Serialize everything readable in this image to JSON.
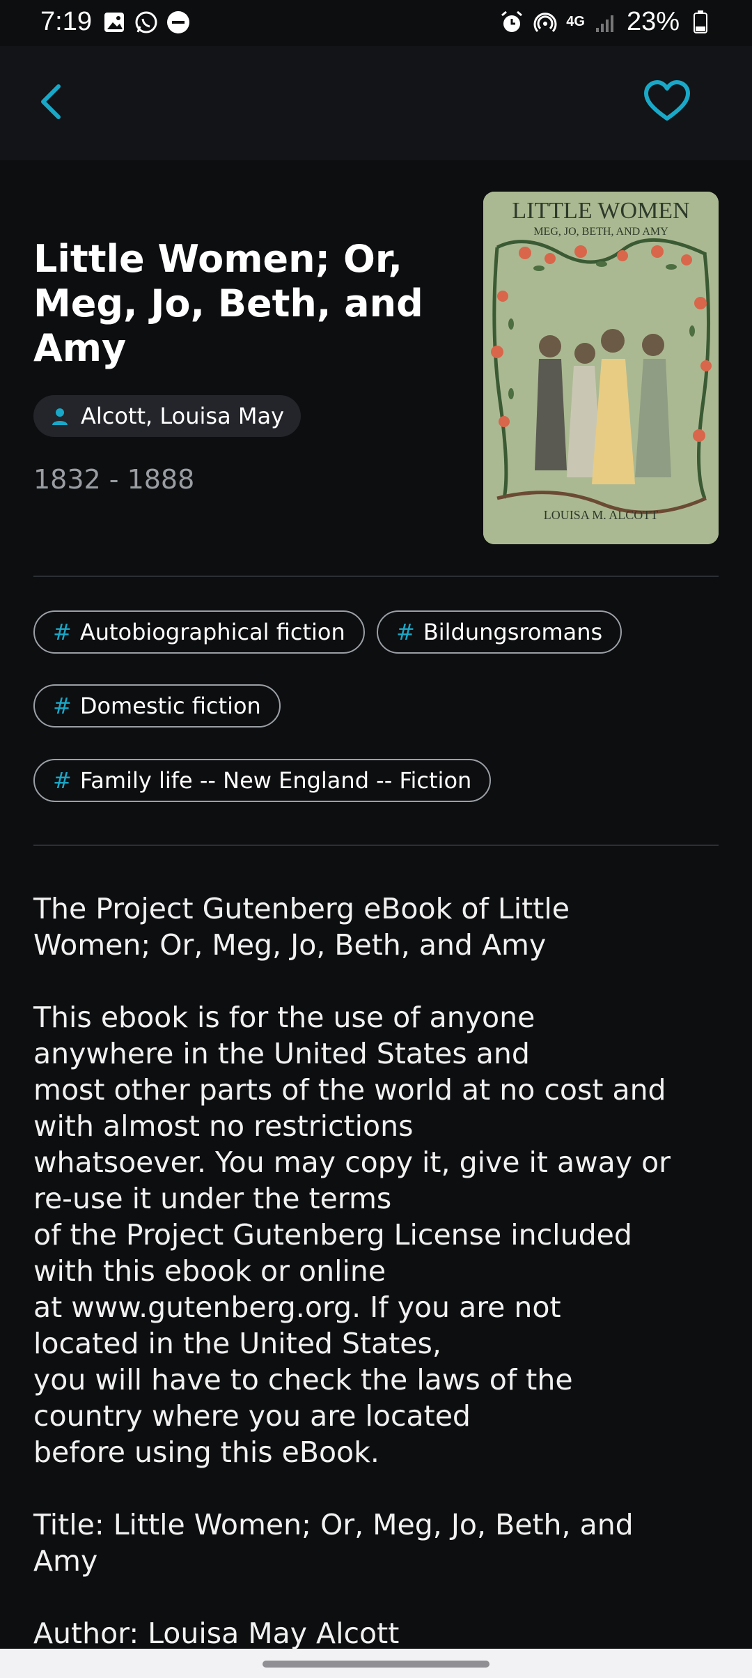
{
  "status_bar": {
    "time": "7:19",
    "battery": "23%",
    "network": "4G"
  },
  "header": {
    "back_icon": "chevron-left-icon",
    "favorite_icon": "heart-outline-icon",
    "accent_color": "#19a8c8"
  },
  "book": {
    "title": "Little Women; Or, Meg, Jo, Beth, and Amy",
    "author": "Alcott, Louisa May",
    "years": "1832 - 1888",
    "cover": {
      "title": "LITTLE WOMEN",
      "subtitle": "MEG, JO, BETH, AND AMY",
      "author": "LOUISA M. ALCOTT"
    }
  },
  "tags": [
    "Autobiographical fiction",
    "Bildungsromans",
    "Domestic fiction",
    "Family life -- New England -- Fiction"
  ],
  "tag_prefix": "#",
  "description": "The Project Gutenberg eBook of Little\nWomen; Or, Meg, Jo, Beth, and Amy\n\nThis ebook is for the use of anyone\nanywhere in the United States and\nmost other parts of the world at no cost and\nwith almost no restrictions\nwhatsoever. You may copy it, give it away or\nre-use it under the terms\nof the Project Gutenberg License included\nwith this ebook or online\nat www.gutenberg.org. If you are not\nlocated in the United States,\nyou will have to check the laws of the\ncountry where you are located\nbefore using this eBook.\n\nTitle: Little Women; Or, Meg, Jo, Beth, and\nAmy\n\nAuthor: Louisa May Alcott"
}
